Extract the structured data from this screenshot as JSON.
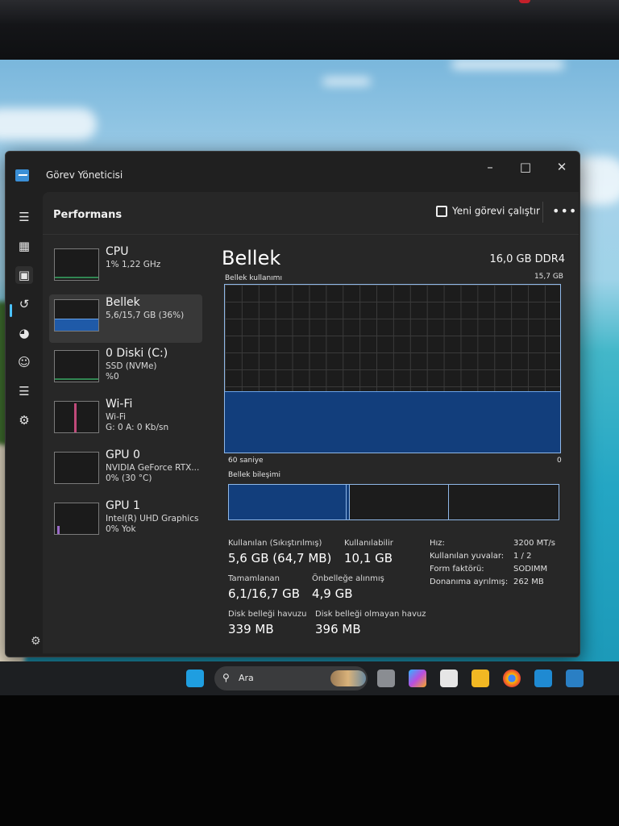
{
  "window": {
    "title": "Görev Yöneticisi"
  },
  "header": {
    "title": "Performans",
    "run_task_label": "Yeni görevi çalıştır",
    "more_label": "•••"
  },
  "nav": {
    "items": [
      "menu-icon",
      "processes-icon",
      "performance-icon",
      "app-history-icon",
      "startup-icon",
      "users-icon",
      "details-icon",
      "services-icon"
    ],
    "settings_icon": "gear-icon"
  },
  "perf_list": [
    {
      "name": "CPU",
      "sub1": "1% 1,22 GHz",
      "sub2": ""
    },
    {
      "name": "Bellek",
      "sub1": "5,6/15,7 GB (36%)",
      "sub2": ""
    },
    {
      "name": "0 Diski (C:)",
      "sub1": "SSD (NVMe)",
      "sub2": "%0"
    },
    {
      "name": "Wi-Fi",
      "sub1": "Wi-Fi",
      "sub2": "G: 0 A: 0 Kb/sn"
    },
    {
      "name": "GPU 0",
      "sub1": "NVIDIA GeForce RTX...",
      "sub2": "0% (30 °C)"
    },
    {
      "name": "GPU 1",
      "sub1": "Intel(R) UHD Graphics",
      "sub2": "0% Yok"
    }
  ],
  "detail": {
    "title": "Bellek",
    "spec": "16,0 GB DDR4",
    "usage_label": "Bellek kullanımı",
    "usage_max": "15,7 GB",
    "usage_fraction": 0.36,
    "time_label": "60 saniye",
    "time_end": "0",
    "composition_label": "Bellek bileşimi",
    "composition": {
      "in_use_fraction": 0.357,
      "modified_fraction": 0.01,
      "standby_fraction": 0.3,
      "free_fraction": 0.333
    },
    "stats": {
      "in_use_label": "Kullanılan (Sıkıştırılmış)",
      "in_use_value": "5,6 GB (64,7 MB)",
      "available_label": "Kullanılabilir",
      "available_value": "10,1 GB",
      "committed_label": "Tamamlanan",
      "committed_value": "6,1/16,7 GB",
      "cached_label": "Önbelleğe alınmış",
      "cached_value": "4,9 GB",
      "paged_label": "Disk belleği havuzu",
      "paged_value": "339 MB",
      "nonpaged_label": "Disk belleği olmayan havuz",
      "nonpaged_value": "396 MB"
    },
    "kv": [
      {
        "k": "Hız:",
        "v": "3200 MT/s"
      },
      {
        "k": "Kullanılan yuvalar:",
        "v": "1 / 2"
      },
      {
        "k": "Form faktörü:",
        "v": "SODIMM"
      },
      {
        "k": "Donanıma ayrılmış:",
        "v": "262 MB"
      }
    ]
  },
  "taskbar": {
    "search_label": "Ara"
  }
}
